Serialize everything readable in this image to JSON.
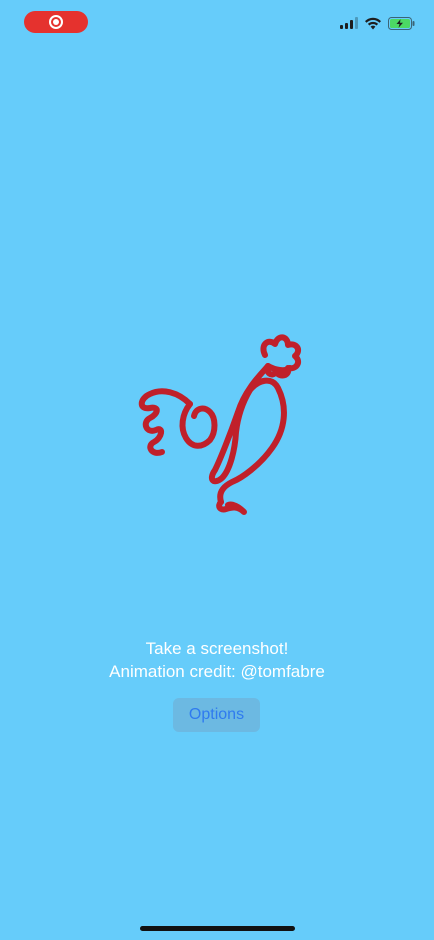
{
  "status_bar": {
    "recording_indicator": "record-icon",
    "signal_icon": "cellular-signal-icon",
    "wifi_icon": "wifi-icon",
    "battery_icon": "battery-charging-icon",
    "battery_color": "#4CD964"
  },
  "content": {
    "illustration": "rooster-line-drawing",
    "illustration_color": "#C0202A",
    "line1": "Take a screenshot!",
    "line2": "Animation credit: @tomfabre"
  },
  "buttons": {
    "options_label": "Options"
  },
  "colors": {
    "background": "#66CCFA",
    "accent": "#2F7BEF"
  }
}
